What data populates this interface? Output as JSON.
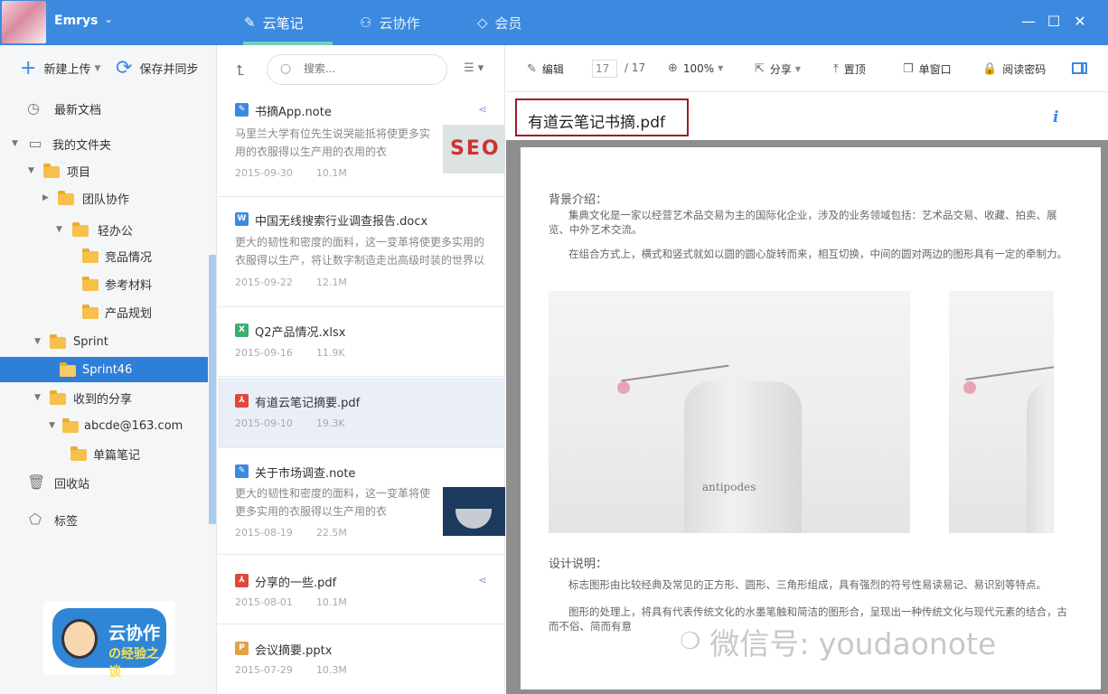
{
  "app": {
    "username": "Emrys",
    "tabs": [
      {
        "label": "云笔记",
        "icon": "pencil-icon",
        "active": true
      },
      {
        "label": "云协作",
        "icon": "people-icon",
        "active": false
      },
      {
        "label": "会员",
        "icon": "diamond-icon",
        "active": false
      }
    ],
    "accent_color": "#3c8ae0"
  },
  "sidebar": {
    "new_upload_label": "新建上传",
    "save_sync_label": "保存并同步",
    "recent_label": "最新文档",
    "my_folders_label": "我的文件夹",
    "tree": [
      "项目",
      "团队协作",
      "轻办公",
      "竞品情况",
      "参考材料",
      "产品规划",
      "Sprint",
      "Sprint46",
      "收到的分享",
      "abcde@163.com",
      "单篇笔记"
    ],
    "trash_label": "回收站",
    "tags_label": "标签",
    "promo": {
      "line1": "云协作",
      "line2": "の经验之谈"
    }
  },
  "list": {
    "search_placeholder": "搜索...",
    "notes": [
      {
        "title": "书摘App.note",
        "snippet": "马里兰大学有位先生说哭能抵将使更多实用的衣服得以生产用的衣用的衣",
        "date": "2015-09-30",
        "size": "10.1M",
        "type": "note",
        "shared": true
      },
      {
        "title": "中国无线搜索行业调查报告.docx",
        "snippet": "更大的韧性和密度的面料，这一变革将使更多实用的衣服得以生产，将让数字制造走出高级时装的世界以",
        "date": "2015-09-22",
        "size": "12.1M",
        "type": "word",
        "shared": false
      },
      {
        "title": "Q2产品情况.xlsx",
        "snippet": "",
        "date": "2015-09-16",
        "size": "11.9K",
        "type": "excel",
        "shared": false
      },
      {
        "title": "有道云笔记摘要.pdf",
        "snippet": "",
        "date": "2015-09-10",
        "size": "19.3K",
        "type": "pdf",
        "shared": false
      },
      {
        "title": "关于市场调查.note",
        "snippet": "更大的韧性和密度的面料，这一变革将使更多实用的衣服得以生产用的衣",
        "date": "2015-08-19",
        "size": "22.5M",
        "type": "note",
        "shared": false
      },
      {
        "title": "分享的一些.pdf",
        "snippet": "",
        "date": "2015-08-01",
        "size": "10.1M",
        "type": "pdf",
        "shared": true
      },
      {
        "title": "会议摘要.pptx",
        "snippet": "",
        "date": "2015-07-29",
        "size": "10.3M",
        "type": "ppt",
        "shared": false
      }
    ]
  },
  "viewer": {
    "toolbar": {
      "edit_label": "编辑",
      "page_current": "17",
      "page_total": "/ 17",
      "zoom": "100%",
      "share_label": "分享",
      "pin_label": "置顶",
      "single_window_label": "单窗口",
      "password_label": "阅读密码"
    },
    "doc_title": "有道云笔记书摘.pdf",
    "info_glyph": "i",
    "page": {
      "section1_title": "背景介绍：",
      "para1": "集典文化是一家以经营艺术品交易为主的国际化企业，涉及的业务领域包括：艺术品交易、收藏、拍卖、展览、中外艺术交流。",
      "para2": "在组合方式上，横式和竖式就如以圆的圆心旋转而来，相互切换，中间的圆对两边的图形具有一定的牵制力。",
      "photo_text": "antipodes",
      "section2_title": "设计说明：",
      "para3": "标志图形由比较经典及常见的正方形、圆形、三角形组成，具有强烈的符号性易读易记、易识别等特点。",
      "para4": "图形的处理上，将具有代表传统文化的水墨笔触和简洁的图形合，呈现出一种传统文化与现代元素的结合，古而不俗、简而有意"
    },
    "watermark": "微信号: youdaonote"
  }
}
